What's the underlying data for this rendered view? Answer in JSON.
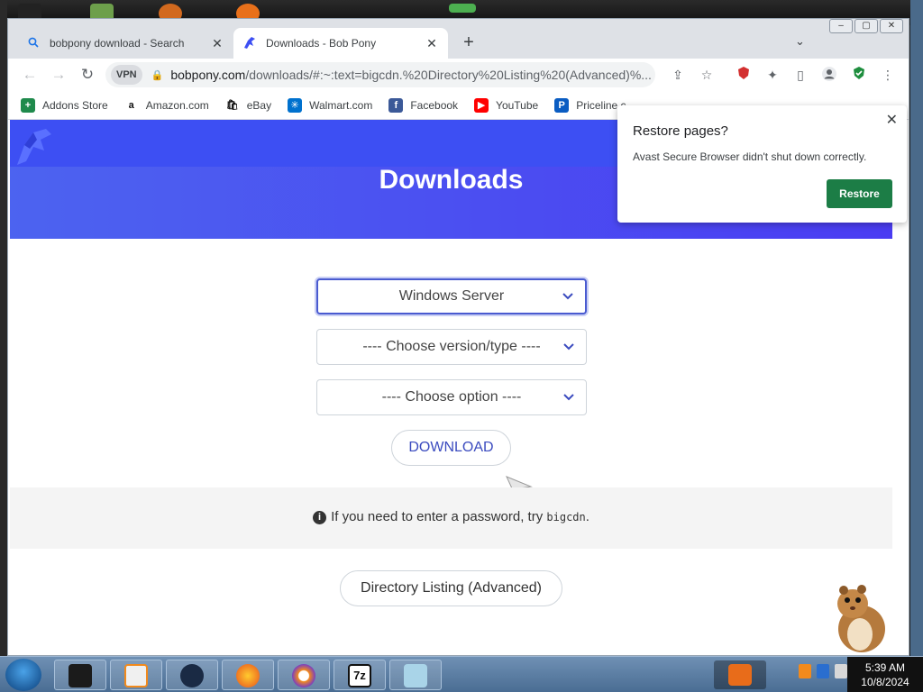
{
  "tabs": [
    {
      "title": "bobpony download - Search",
      "icon": "search-icon"
    },
    {
      "title": "Downloads - Bob Pony",
      "icon": "bobpony-logo-icon"
    }
  ],
  "new_tab_label": "+",
  "tab_search_label": "⌄",
  "toolbar": {
    "vpn_label": "VPN",
    "url_main": "bobpony.com",
    "url_rest": "/downloads/#:~:text=bigcdn.%20Directory%20Listing%20(Advanced)%..."
  },
  "bookmarks": [
    {
      "label": "Addons Store",
      "icon": "addons-icon",
      "color": "#1f8a4c",
      "glyph": "+"
    },
    {
      "label": "Amazon.com",
      "icon": "amazon-icon",
      "color": "#ffffff",
      "glyph": "a"
    },
    {
      "label": "eBay",
      "icon": "ebay-icon",
      "color": "#ffffff",
      "glyph": "🛍"
    },
    {
      "label": "Walmart.com",
      "icon": "walmart-icon",
      "color": "#0071ce",
      "glyph": "✳"
    },
    {
      "label": "Facebook",
      "icon": "facebook-icon",
      "color": "#3b5998",
      "glyph": "f"
    },
    {
      "label": "YouTube",
      "icon": "youtube-icon",
      "color": "#ff0000",
      "glyph": "▶"
    },
    {
      "label": "Priceline.c",
      "icon": "priceline-icon",
      "color": "#0a5cc2",
      "glyph": "P"
    }
  ],
  "page": {
    "hero_title": "Downloads",
    "select_os": "Windows Server",
    "select_version": "---- Choose version/type ----",
    "select_option": "---- Choose option ----",
    "download_label": "DOWNLOAD",
    "info_prefix": "If you need to enter a password, try",
    "info_code": "bigcdn",
    "info_suffix": ".",
    "directory_label": "Directory Listing (Advanced)"
  },
  "popup": {
    "title": "Restore pages?",
    "message": "Avast Secure Browser didn't shut down correctly.",
    "button": "Restore"
  },
  "taskbar": {
    "time": "5:39 AM",
    "date": "10/8/2024",
    "apps": [
      "media-center-icon",
      "vlc-player-icon",
      "globe-app-icon",
      "firefox-icon",
      "avast-browser-icon",
      "7zip-icon",
      "notepad-icon"
    ]
  },
  "colors": {
    "hero": "#4a5bf2",
    "accent": "#3b4bbf",
    "restore_button": "#1c7d46"
  }
}
